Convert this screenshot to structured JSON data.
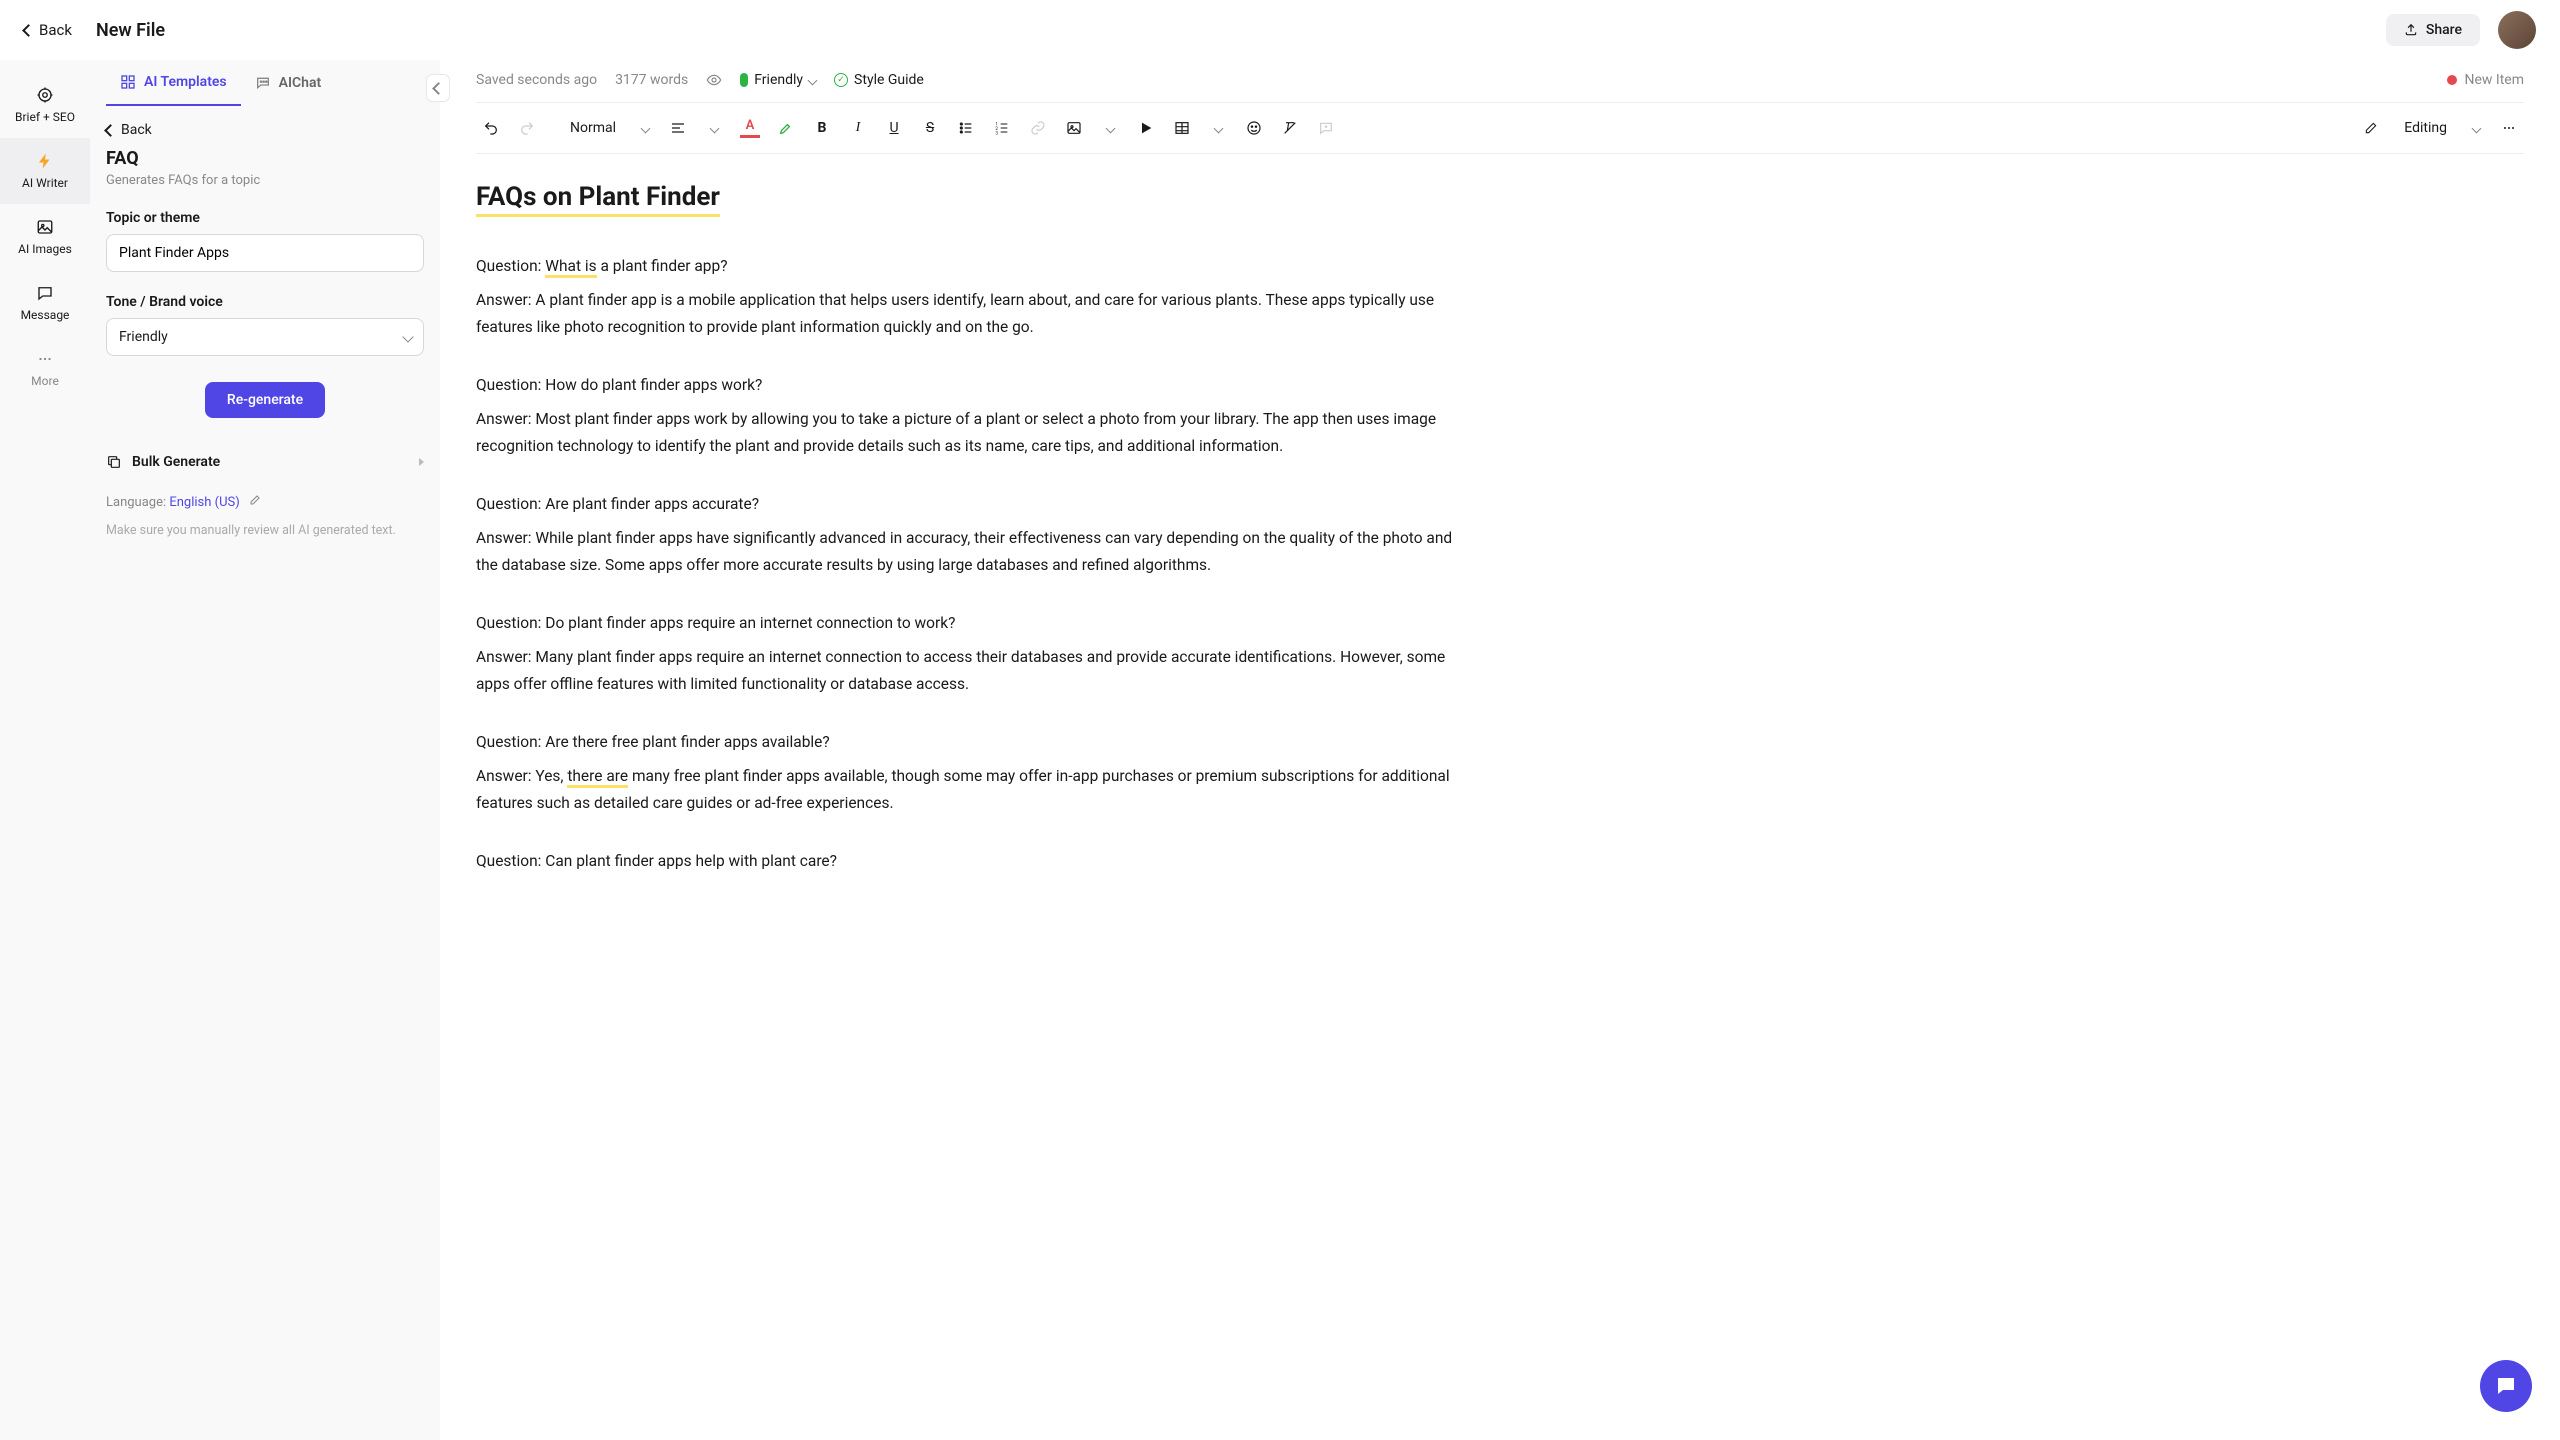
{
  "header": {
    "back": "Back",
    "file_title": "New File",
    "share": "Share"
  },
  "rail": {
    "brief": "Brief + SEO",
    "ai_writer": "AI Writer",
    "ai_images": "AI Images",
    "message": "Message",
    "more": "More"
  },
  "tabs": {
    "ai_templates": "AI Templates",
    "ai_chat": "AIChat"
  },
  "sidebar": {
    "back": "Back",
    "panel_title": "FAQ",
    "panel_desc": "Generates FAQs for a topic",
    "topic_label": "Topic or theme",
    "topic_value": "Plant Finder Apps",
    "tone_label": "Tone / Brand voice",
    "tone_value": "Friendly",
    "regenerate": "Re-generate",
    "bulk": "Bulk Generate",
    "lang_label": "Language: ",
    "lang_value": "English (US)",
    "review_note": "Make sure you manually review all AI generated text."
  },
  "meta": {
    "saved": "Saved seconds ago",
    "words": "3177 words",
    "friendly": "Friendly",
    "style_guide": "Style Guide",
    "new_item": "New Item"
  },
  "toolbar": {
    "normal": "Normal",
    "editing": "Editing"
  },
  "doc": {
    "title": "FAQs on Plant Finder",
    "q1a": "Question: ",
    "q1b": "What is",
    "q1c": " a plant finder app?",
    "a1": "Answer: A plant finder app is a mobile application that helps users identify, learn about, and care for various plants. These apps typically use features like photo recognition to provide plant information quickly and on the go.",
    "q2": "Question: How do plant finder apps work?",
    "a2": "Answer: Most plant finder apps work by allowing you to take a picture of a plant or select a photo from your library. The app then uses image recognition technology to identify the plant and provide details such as its name, care tips, and additional information.",
    "q3": "Question: Are plant finder apps accurate?",
    "a3": "Answer: While plant finder apps have significantly advanced in accuracy, their effectiveness can vary depending on the quality of the photo and the database size. Some apps offer more accurate results by using large databases and refined algorithms.",
    "q4": "Question: Do plant finder apps require an internet connection to work?",
    "a4": "Answer: Many plant finder apps require an internet connection to access their databases and provide accurate identifications. However, some apps offer offline features with limited functionality or database access.",
    "q5": "Question: Are there free plant finder apps available?",
    "a5a": "Answer: Yes, ",
    "a5b": "there are",
    "a5c": " many free plant finder apps available, though some may offer in-app purchases or premium subscriptions for additional features such as detailed care guides or ad-free experiences.",
    "q6": "Question: Can plant finder apps help with plant care?"
  }
}
